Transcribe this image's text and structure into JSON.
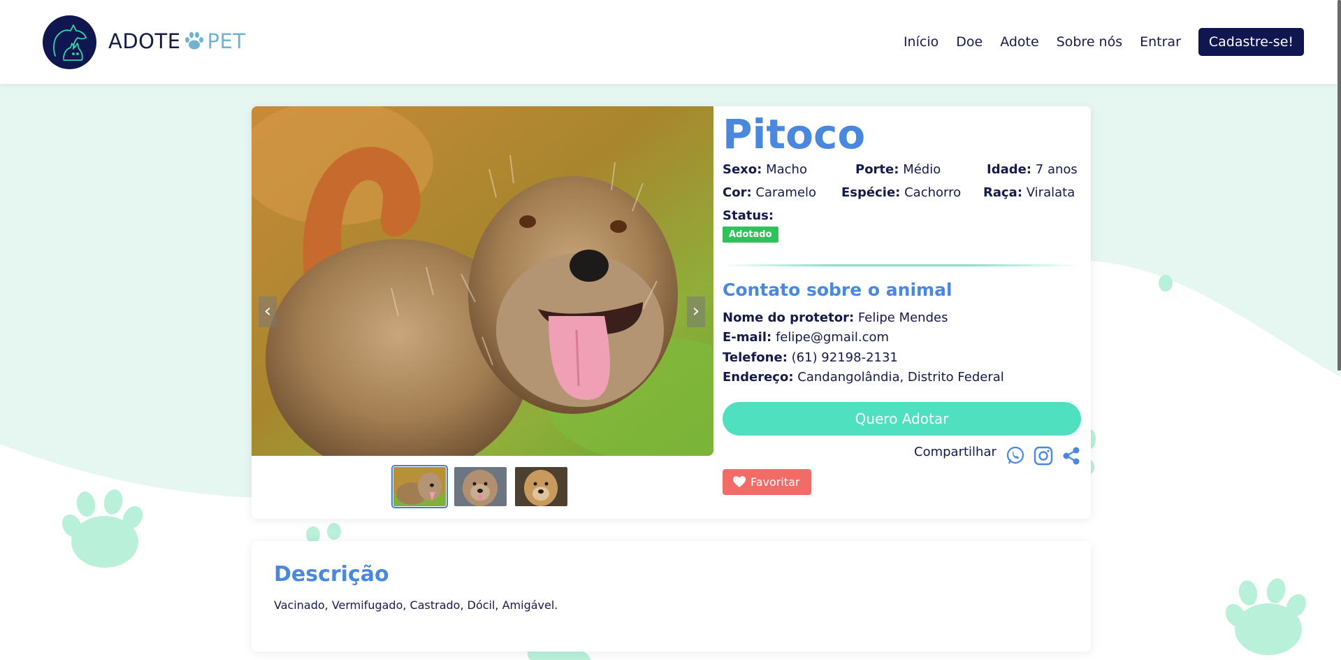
{
  "brand": {
    "name_primary": "ADOTE",
    "name_secondary": "PET",
    "logo_icon": "dog-cat-logo-icon",
    "paw_icon": "paw-icon"
  },
  "nav": {
    "items": [
      "Início",
      "Doe",
      "Adote",
      "Sobre nós",
      "Entrar"
    ],
    "cta": "Cadastre-se!"
  },
  "pet": {
    "name": "Pitoco",
    "attributes": [
      {
        "label": "Sexo:",
        "value": "Macho"
      },
      {
        "label": "Porte:",
        "value": "Médio"
      },
      {
        "label": "Idade:",
        "value": "7 anos"
      },
      {
        "label": "Cor:",
        "value": "Caramelo"
      },
      {
        "label": "Espécie:",
        "value": "Cachorro"
      },
      {
        "label": "Raça:",
        "value": "Viralata"
      }
    ],
    "status_label": "Status:",
    "status_value": "Adotado"
  },
  "gallery": {
    "prev_icon": "‹",
    "next_icon": "›",
    "thumbnails": 3,
    "active_thumbnail": 1
  },
  "contact": {
    "title": "Contato sobre o animal",
    "fields": [
      {
        "label": "Nome do protetor:",
        "value": "Felipe Mendes"
      },
      {
        "label": "E-mail:",
        "value": "felipe@gmail.com"
      },
      {
        "label": "Telefone:",
        "value": "(61) 92198-2131"
      },
      {
        "label": "Endereço:",
        "value": "Candangolândia, Distrito Federal"
      }
    ]
  },
  "actions": {
    "adopt": "Quero Adotar",
    "share_label": "Compartilhar",
    "share_icons": [
      "whatsapp-icon",
      "instagram-icon",
      "share-icon"
    ],
    "favorite": "Favoritar"
  },
  "description": {
    "title": "Descrição",
    "text": "Vacinado, Vermifugado, Castrado, Dócil, Amigável."
  },
  "colors": {
    "primary_dark": "#0f1650",
    "accent_blue": "#4a88e0",
    "mint": "#4fe0bf",
    "status_green": "#2fc25b",
    "favorite_red": "#f26b66",
    "background_mint": "#e6f6f1"
  }
}
